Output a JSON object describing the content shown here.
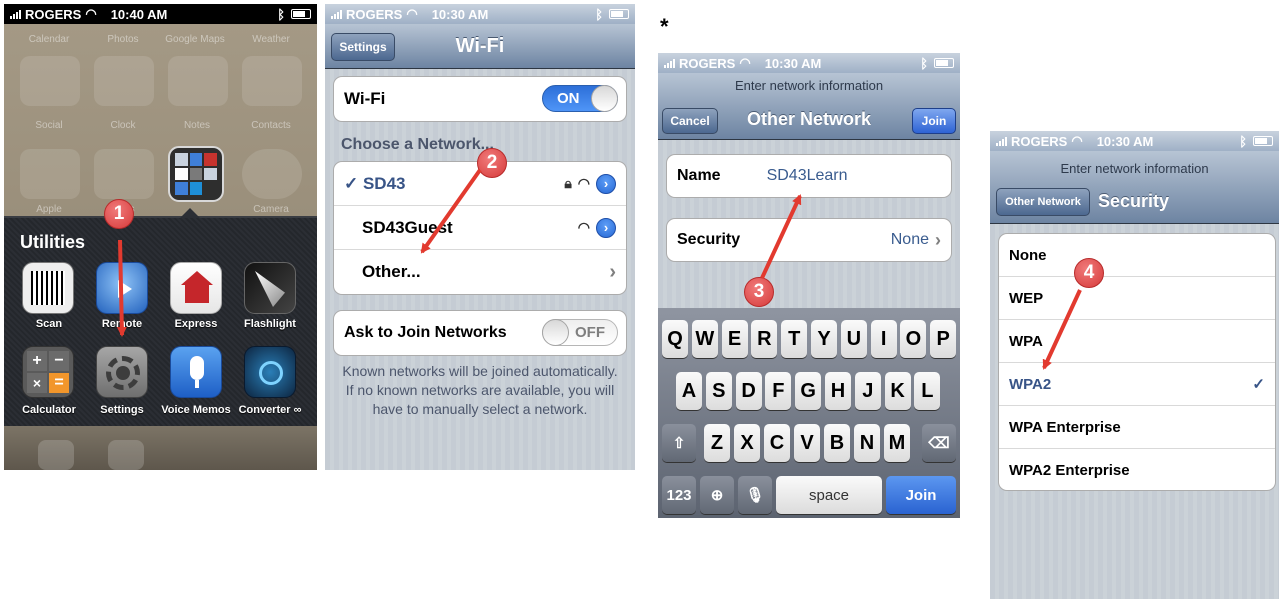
{
  "asterisk": "*",
  "status": {
    "carrier": "ROGERS",
    "time1": "10:40 AM",
    "time2": "10:30 AM",
    "time3": "10:30 AM",
    "time4": "10:30 AM"
  },
  "home": {
    "ghost_row1": [
      "Calendar",
      "Photos",
      "Google Maps",
      "Weather"
    ],
    "ghost_row2": [
      "Social",
      "Clock",
      "Notes",
      "Contacts"
    ],
    "ghost_row3": [
      "Apple",
      "Tools",
      "",
      "Camera"
    ],
    "folder_title": "Utilities",
    "apps_row1": [
      "Scan",
      "Remote",
      "Express",
      "Flashlight"
    ],
    "apps_row2": [
      "Calculator",
      "Settings",
      "Voice Memos",
      "Converter ∞"
    ]
  },
  "wifi": {
    "back": "Settings",
    "title": "Wi-Fi",
    "toggle_label": "Wi-Fi",
    "toggle_value": "ON",
    "section": "Choose a Network...",
    "networks": [
      "✓ SD43",
      "SD43Guest",
      "Other..."
    ],
    "ask_label": "Ask to Join Networks",
    "ask_value": "OFF",
    "footer": "Known networks will be joined automatically. If no known networks are available, you will have to manually select a network."
  },
  "other": {
    "prompt": "Enter network information",
    "cancel": "Cancel",
    "title": "Other Network",
    "join": "Join",
    "name_label": "Name",
    "name_value": "SD43Learn",
    "security_label": "Security",
    "security_value": "None",
    "keys_row1": [
      "Q",
      "W",
      "E",
      "R",
      "T",
      "Y",
      "U",
      "I",
      "O",
      "P"
    ],
    "keys_row2": [
      "A",
      "S",
      "D",
      "F",
      "G",
      "H",
      "J",
      "K",
      "L"
    ],
    "keys_row3": [
      "Z",
      "X",
      "C",
      "V",
      "B",
      "N",
      "M"
    ],
    "key_123": "123",
    "key_space": "space",
    "key_join": "Join"
  },
  "security": {
    "prompt": "Enter network information",
    "back": "Other Network",
    "title": "Security",
    "options": [
      "None",
      "WEP",
      "WPA",
      "WPA2",
      "WPA Enterprise",
      "WPA2 Enterprise"
    ],
    "selected": "WPA2"
  },
  "steps": [
    "1",
    "2",
    "3",
    "4"
  ],
  "colors": {
    "accent": "#3a66b8",
    "arrow": "#e23a2f",
    "badge": "#d63a3a"
  }
}
